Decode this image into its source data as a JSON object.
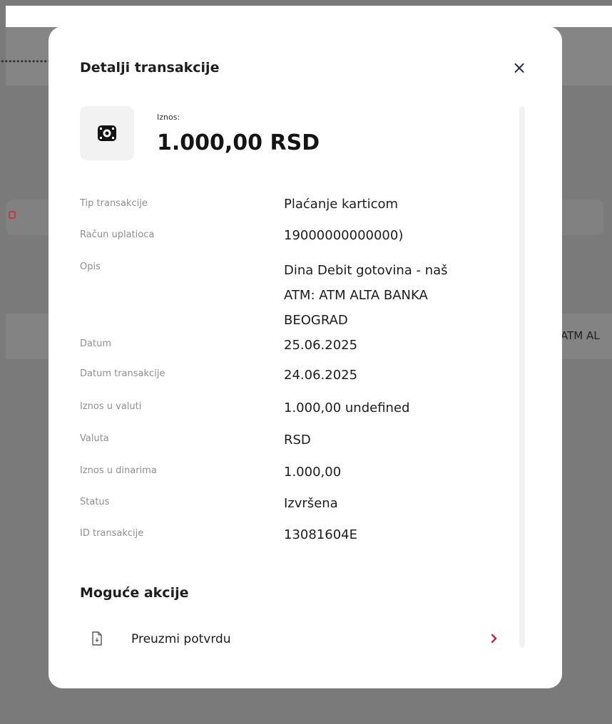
{
  "background": {
    "masked_text": "••••••••••••••••••••••••••••••••",
    "row_text": "ATM AL"
  },
  "modal": {
    "title": "Detalji transakcije",
    "close_symbol": "×",
    "amount_label": "Iznos:",
    "amount_value": "1.000,00 RSD",
    "amount_icon": "cash-icon",
    "details": [
      {
        "label": "Tip transakcije",
        "value": "Plaćanje karticom"
      },
      {
        "label": "Račun uplatioca",
        "value": "19000000000000)"
      },
      {
        "label": "Opis",
        "value": "Dina Debit gotovina - naš ATM: ATM ALTA BANKA BEOGRAD"
      },
      {
        "label": "Datum",
        "value": "25.06.2025"
      },
      {
        "label": "Datum transakcije",
        "value": "24.06.2025"
      },
      {
        "label": "Iznos u valuti",
        "value": "1.000,00 undefined"
      },
      {
        "label": "Valuta",
        "value": "RSD"
      },
      {
        "label": "Iznos u dinarima",
        "value": "1.000,00"
      },
      {
        "label": "Status",
        "value": "Izvršena"
      },
      {
        "label": "ID transakcije",
        "value": "13081604E"
      }
    ],
    "actions_title": "Moguće akcije",
    "actions": [
      {
        "label": "Preuzmi potvrdu",
        "icon": "document-icon",
        "arrow_icon": "chevron-right-icon"
      }
    ]
  },
  "colors": {
    "overlay": "#7a7a7a",
    "accent": "#d0213a",
    "text_primary": "#1c1c1c",
    "text_secondary": "#8e8e8e"
  }
}
